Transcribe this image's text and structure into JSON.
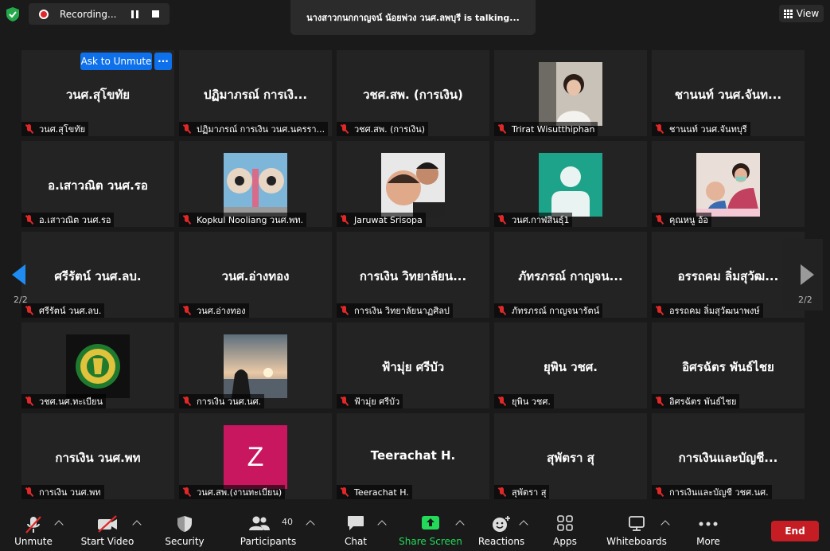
{
  "topbar": {
    "recording_label": "Recording...",
    "talking_text": "นางสาวกนกกาญจน์ น้อยพ่วง วนศ.ลพบุรี is  talking...",
    "view_label": "View"
  },
  "participant_actions": {
    "ask_to_unmute": "Ask to Unmute",
    "more": "···"
  },
  "tiles": [
    {
      "name": "วนศ.สุโขทัย",
      "label": "วนศ.สุโขทัย",
      "pic": null
    },
    {
      "name": "ปฏิมาภรณ์ การเงิ...",
      "label": "ปฏิมาภรณ์ การเงิน วนศ.นครรา...",
      "pic": null
    },
    {
      "name": "วชศ.สพ. (การเงิน)",
      "label": "วชศ.สพ. (การเงิน)",
      "pic": null
    },
    {
      "name": "",
      "label": "Trirat Wisutthiphan",
      "pic": "woman-white-shirt"
    },
    {
      "name": "ชานนท์ วนศ.จันท...",
      "label": "ชานนท์ วนศ.จันทบุรี",
      "pic": null
    },
    {
      "name": "อ.เสาวณิต วนศ.รอ",
      "label": "อ.เสาวณิต วนศ.รอ",
      "pic": null
    },
    {
      "name": "",
      "label": "Kopkul Nooliang วนศ.พท.",
      "pic": "mural"
    },
    {
      "name": "",
      "label": "Jaruwat Srisopa",
      "pic": "selfie-child"
    },
    {
      "name": "",
      "label": "วนศ.กาฬสินธุ์1",
      "pic": "default-avatar"
    },
    {
      "name": "",
      "label": "คุณหนู อ้อ",
      "pic": "mother-child"
    },
    {
      "name": "ศรีรัตน์ วนศ.ลบ.",
      "label": "ศรีรัตน์ วนศ.ลบ.",
      "pic": null
    },
    {
      "name": "วนศ.อ่างทอง",
      "label": "วนศ.อ่างทอง",
      "pic": null
    },
    {
      "name": "การเงิน วิทยาลัยน...",
      "label": "การเงิน วิทยาลัยนาฏศิลป",
      "pic": null
    },
    {
      "name": "ภัทรภรณ์  กาญจน...",
      "label": "ภัทรภรณ์  กาญจนารัตน์",
      "pic": null
    },
    {
      "name": "อรรถคม ลิ่มสุวัฒ...",
      "label": "อรรถคม ลิ่มสุวัฒนาพงษ์",
      "pic": null
    },
    {
      "name": "",
      "label": "วชศ.นศ.ทะเบียน",
      "pic": "emblem"
    },
    {
      "name": "",
      "label": "การเงิน วนศ.นศ.",
      "pic": "sunset"
    },
    {
      "name": "ฟ้ามุ่ย ศรีบัว",
      "label": "ฟ้ามุ่ย ศรีบัว",
      "pic": null
    },
    {
      "name": "ยุพิน วชศ.",
      "label": "ยุพิน วชศ.",
      "pic": null
    },
    {
      "name": "อิศรฉัตร พันธ์ไชย",
      "label": "อิศรฉัตร พันธ์ไชย",
      "pic": null
    },
    {
      "name": "การเงิน วนศ.พท",
      "label": "การเงิน วนศ.พท",
      "pic": null
    },
    {
      "name": "",
      "label": "วนศ.สพ.(งานทะเบียน)",
      "pic": "letter-z",
      "letter": "Z"
    },
    {
      "name": "Teerachat H.",
      "label": "Teerachat H.",
      "pic": null
    },
    {
      "name": "สุพัตรา สุ",
      "label": "สุพัตรา สุ",
      "pic": null
    },
    {
      "name": "การเงินและบัญชี...",
      "label": "การเงินและบัญชี วชศ.นศ.",
      "pic": null
    }
  ],
  "pagination": {
    "left": "2/2",
    "right": "2/2"
  },
  "toolbar": {
    "unmute": "Unmute",
    "start_video": "Start Video",
    "security": "Security",
    "participants": "Participants",
    "participants_count": "40",
    "chat": "Chat",
    "share_screen": "Share Screen",
    "reactions": "Reactions",
    "apps": "Apps",
    "whiteboards": "Whiteboards",
    "more": "More",
    "end": "End"
  },
  "colors": {
    "accent_blue": "#0e71eb",
    "share_green": "#23d959",
    "end_red": "#c61d25",
    "mute_red": "#e02828"
  }
}
